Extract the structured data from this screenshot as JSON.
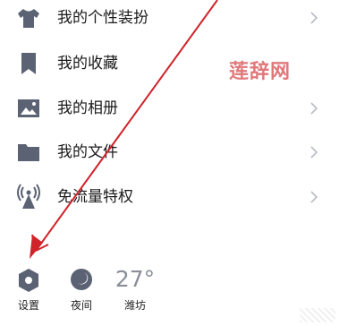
{
  "menu": {
    "items": [
      {
        "label": "我的个性装扮",
        "icon": "shirt-icon"
      },
      {
        "label": "我的收藏",
        "icon": "bookmark-icon"
      },
      {
        "label": "我的相册",
        "icon": "image-icon"
      },
      {
        "label": "我的文件",
        "icon": "folder-icon"
      },
      {
        "label": "免流量特权",
        "icon": "signal-tower-icon"
      }
    ]
  },
  "watermark": "莲辞网",
  "bottom_bar": {
    "settings": {
      "label": "设置",
      "icon": "hexagon-gear-icon"
    },
    "night": {
      "label": "夜间",
      "icon": "moon-icon"
    },
    "weather": {
      "temperature": "27°",
      "city": "潍坊"
    }
  },
  "colors": {
    "icon": "#5b6273",
    "arrow": "#d0232a",
    "watermark": "#e0787a"
  }
}
